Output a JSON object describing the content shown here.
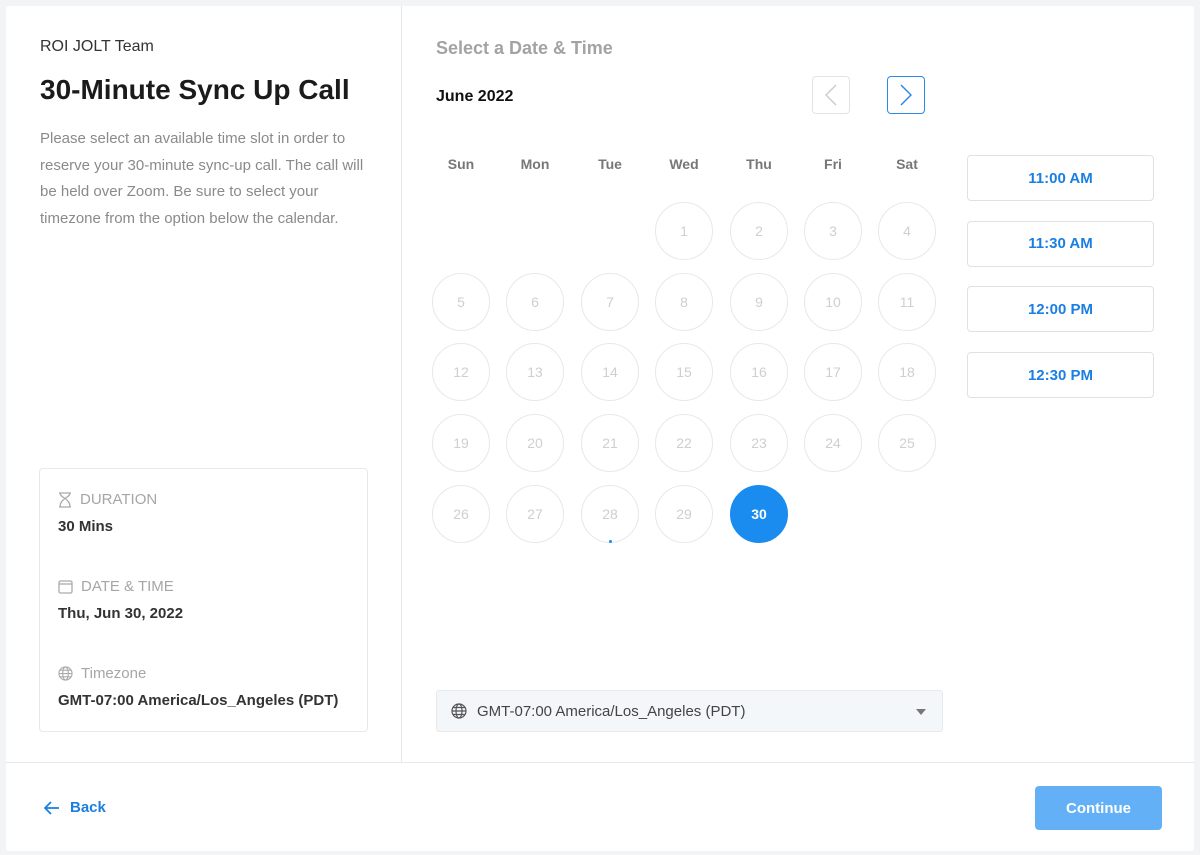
{
  "left": {
    "team": "ROI JOLT Team",
    "title": "30-Minute Sync Up Call",
    "description": "Please select an available time slot in order to reserve your 30-minute sync-up call. The call will be held over Zoom. Be sure to select your timezone from the option below the calendar.",
    "duration_label": "DURATION",
    "duration_value": "30 Mins",
    "datetime_label": "DATE & TIME",
    "datetime_value": "Thu, Jun 30, 2022",
    "timezone_label": "Timezone",
    "timezone_value": "GMT-07:00 America/Los_Angeles (PDT)"
  },
  "right": {
    "heading": "Select a Date & Time",
    "month": "June 2022",
    "weekdays": [
      "Sun",
      "Mon",
      "Tue",
      "Wed",
      "Thu",
      "Fri",
      "Sat"
    ],
    "first_weekday": 3,
    "days_in_month": 30,
    "selected_day": 30,
    "today_marker_day": 28,
    "disabled_days_through": 29,
    "slots": [
      "11:00 AM",
      "11:30 AM",
      "12:00 PM",
      "12:30 PM"
    ],
    "timezone": "GMT-07:00 America/Los_Angeles (PDT)"
  },
  "footer": {
    "back": "Back",
    "continue": "Continue"
  },
  "colors": {
    "accent": "#1a8cf0"
  }
}
